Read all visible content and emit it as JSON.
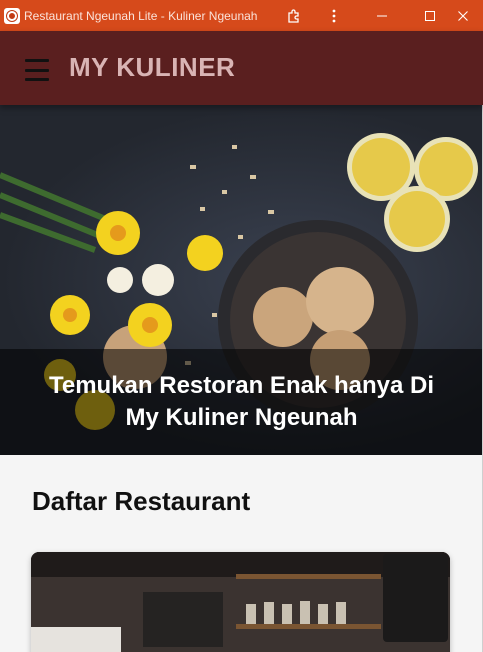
{
  "window": {
    "title": "Restaurant Ngeunah Lite - Kuliner Ngeunah"
  },
  "header": {
    "brand": "MY KULINER"
  },
  "hero": {
    "caption": "Temukan Restoran Enak hanya Di My Kuliner Ngeunah"
  },
  "main": {
    "section_title": "Daftar Restaurant"
  },
  "colors": {
    "titlebar": "#d64a1b",
    "appbar": "#5a1f1f",
    "brand_text": "#d9b4b4"
  },
  "icons": {
    "menu": "hamburger-icon",
    "extensions": "puzzle-icon",
    "more": "more-vertical-icon",
    "minimize": "minimize-icon",
    "maximize": "maximize-icon",
    "close": "close-icon"
  }
}
